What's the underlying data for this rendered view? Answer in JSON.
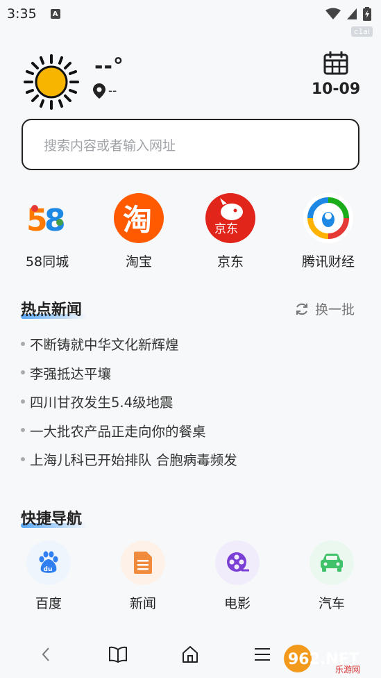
{
  "status_bar": {
    "time": "3:35",
    "notification_glyph": "A",
    "corner_tag": "c1ai"
  },
  "weather": {
    "temperature": "--°",
    "location": "--",
    "date": "10-09",
    "icon": "sun-icon"
  },
  "search": {
    "placeholder": "搜索内容或者输入网址"
  },
  "apps": [
    {
      "label": "58同城",
      "icon": "58-icon"
    },
    {
      "label": "淘宝",
      "icon": "taobao-icon"
    },
    {
      "label": "京东",
      "icon": "jd-icon"
    },
    {
      "label": "腾讯财经",
      "icon": "tencent-finance-icon"
    }
  ],
  "hot_news": {
    "title": "热点新闻",
    "refresh_label": "换一批",
    "items": [
      "不断铸就中华文化新辉煌",
      "李强抵达平壤",
      "四川甘孜发生5.4级地震",
      "一大批农产品正走向你的餐桌",
      "上海儿科已开始排队 合胞病毒频发"
    ]
  },
  "quick_nav": {
    "title": "快捷导航",
    "items": [
      {
        "label": "百度",
        "icon": "baidu-icon",
        "bg": "#eef5fd",
        "color": "#2f7ff0"
      },
      {
        "label": "新闻",
        "icon": "news-icon",
        "bg": "#fdf1e8",
        "color": "#f08a3c"
      },
      {
        "label": "电影",
        "icon": "film-icon",
        "bg": "#f1ecfb",
        "color": "#7b3fd6"
      },
      {
        "label": "汽车",
        "icon": "car-icon",
        "bg": "#eaf8ef",
        "color": "#3fc26a"
      }
    ]
  },
  "site_watermark": {
    "line1": "962.NET",
    "line2": "乐游网"
  },
  "colors": {
    "accent_underline": "#5aa9f6",
    "sun": "#f7b500",
    "taobao": "#ff5a00",
    "jd": "#e1251b"
  }
}
